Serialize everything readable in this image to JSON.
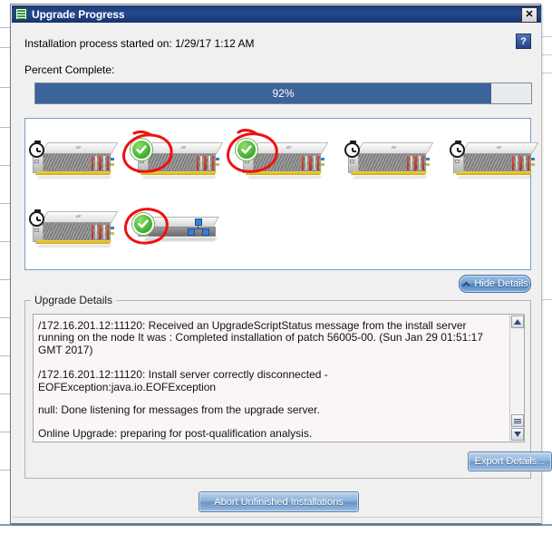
{
  "window": {
    "title": "Upgrade Progress",
    "app_icon": "list-document-icon",
    "close_label": "✕"
  },
  "header": {
    "started_text": "Installation process started on: 1/29/17 1:12 AM",
    "help_label": "?"
  },
  "progress": {
    "label": "Percent Complete:",
    "percent_text": "92%",
    "percent_value": 92,
    "fill_color": "#3c6498",
    "track_color": "#e9ecef"
  },
  "devices": {
    "rows": [
      [
        {
          "type": "rack-server",
          "status": "pending",
          "badge": "clock-icon",
          "annotated": false
        },
        {
          "type": "rack-server",
          "status": "complete",
          "badge": "green-check-icon",
          "annotated": true
        },
        {
          "type": "rack-server",
          "status": "complete",
          "badge": "green-check-icon",
          "annotated": true
        },
        {
          "type": "rack-server",
          "status": "pending",
          "badge": "clock-icon",
          "annotated": false
        },
        {
          "type": "rack-server",
          "status": "pending",
          "badge": "clock-icon",
          "annotated": false
        }
      ],
      [
        {
          "type": "rack-server",
          "status": "pending",
          "badge": "clock-icon",
          "annotated": false
        },
        {
          "type": "network-switch",
          "status": "complete",
          "badge": "green-check-icon",
          "annotated": true
        }
      ]
    ],
    "annotation_color": "#ee1111",
    "complete_color": "#3fae2e"
  },
  "hide_details": {
    "label": "Hide Details",
    "icon": "chevron-up-icon"
  },
  "details": {
    "legend": "Upgrade Details",
    "lines": [
      "/172.16.201.12:11120: Received an UpgradeScriptStatus message from the install server running on the node It was : Completed installation of patch 56005-00. (Sun Jan 29 01:51:17 GMT 2017)",
      "/172.16.201.12:11120: Install server correctly disconnected - EOFException:java.io.EOFException",
      "null: Done listening for messages from the upgrade server.",
      "Online Upgrade: preparing for post-qualification analysis."
    ],
    "scroll_up_glyph": "▲",
    "scroll_down_glyph": "▼",
    "export_label": "Export Details..."
  },
  "footer": {
    "abort_label": "Abort Unfinished Installations"
  }
}
